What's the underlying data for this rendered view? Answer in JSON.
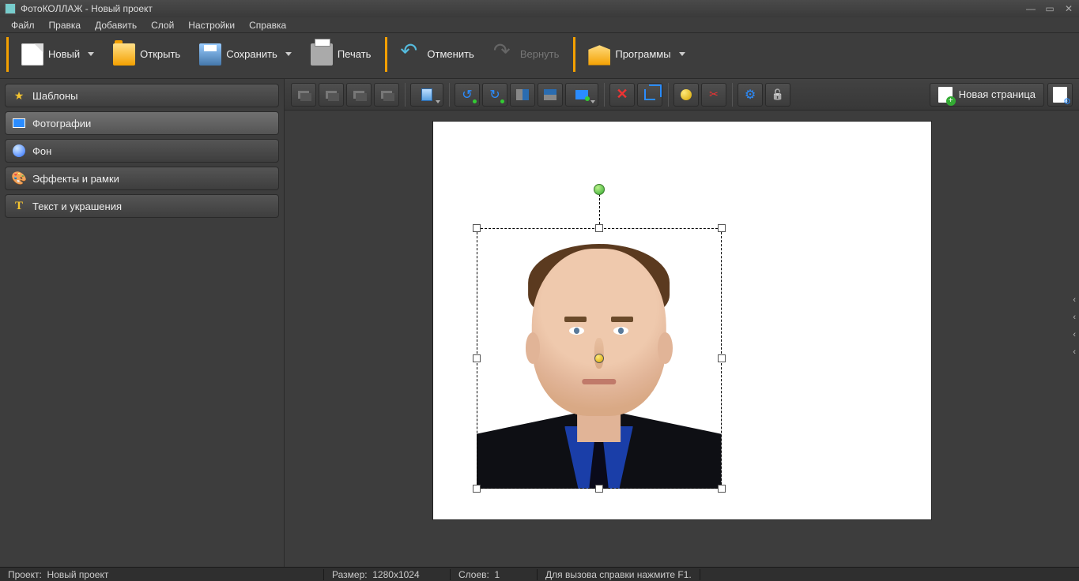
{
  "title": "ФотоКОЛЛАЖ - Новый проект",
  "menu": {
    "file": "Файл",
    "edit": "Правка",
    "add": "Добавить",
    "layer": "Слой",
    "settings": "Настройки",
    "help": "Справка"
  },
  "toolbar": {
    "new": "Новый",
    "open": "Открыть",
    "save": "Сохранить",
    "print": "Печать",
    "undo": "Отменить",
    "redo": "Вернуть",
    "programs": "Программы"
  },
  "sidebar": {
    "items": [
      {
        "label": "Шаблоны"
      },
      {
        "label": "Фотографии"
      },
      {
        "label": "Фон"
      },
      {
        "label": "Эффекты и рамки"
      },
      {
        "label": "Текст и украшения"
      }
    ]
  },
  "editbar": {
    "newpage": "Новая страница"
  },
  "status": {
    "project_label": "Проект:",
    "project_name": "Новый проект",
    "size_label": "Размер:",
    "size_value": "1280x1024",
    "layers_label": "Слоев:",
    "layers_value": "1",
    "help": "Для вызова справки нажмите F1."
  }
}
